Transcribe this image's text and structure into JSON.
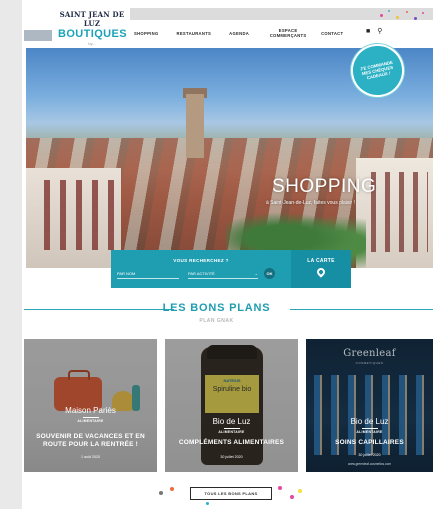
{
  "header": {
    "logo": {
      "line1": "SAINT JEAN DE LUZ",
      "line2": "BOUTIQUES",
      "line3": "by..."
    },
    "nav": [
      {
        "label": "SHOPPING"
      },
      {
        "label": "RESTAURANTS"
      },
      {
        "label": "AGENDA"
      },
      {
        "label": "ESPACE COMMERÇANTS"
      },
      {
        "label": "CONTACT"
      }
    ],
    "icons": [
      "shopping-bag-icon",
      "search-icon"
    ]
  },
  "hero": {
    "title": "SHOPPING",
    "subtitle": "à Saint-Jean-de-Luz, faites vous plaisir !",
    "promo": "J'E COMMANDE MES CHÈQUES CADEAUX !"
  },
  "search": {
    "title": "VOUS RECHERCHEZ ?",
    "name_field": "PAR NOM",
    "activity_field": "PAR ACTIVITÉ",
    "ok_label": "OK",
    "map_label": "LA CARTE"
  },
  "section": {
    "title": "LES BONS PLANS",
    "subtitle": "PLAN GNAK"
  },
  "cards": [
    {
      "name": "Maison Pariès",
      "tag": "ALIMENTAIRE",
      "headline": "SOUVENIR DE VACANCES ET EN ROUTE POUR LA RENTRÉE !",
      "date": "1 août 2020"
    },
    {
      "name": "Bio de Luz",
      "tag": "ALIMENTAIRE",
      "headline": "COMPLÉMENTS ALIMENTAIRES",
      "date": "30 juillet 2020",
      "product_brand": "NATESIS",
      "product_name": "Spiruline bio"
    },
    {
      "name": "Bio de Luz",
      "tag": "ALIMENTAIRE",
      "headline": "SOINS CAPILLAIRES",
      "date": "30 juillet 2020",
      "brand": "Greenleaf",
      "brand_sub": "COSMETIQUES",
      "url": "www.greenleaf-cosmetics.com"
    }
  ],
  "footer": {
    "all_button": "TOUS LES BONS PLANS"
  },
  "colors": {
    "accent": "#1f9db1",
    "accent_dark": "#168ea3"
  }
}
